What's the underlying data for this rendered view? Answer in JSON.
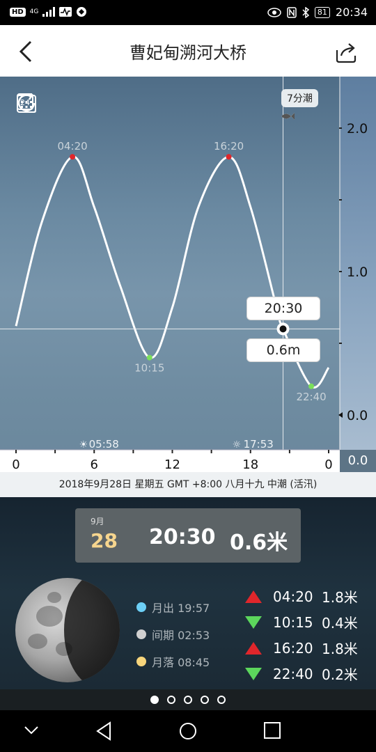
{
  "status": {
    "network_badges": [
      "HD",
      "4G"
    ],
    "battery": "81",
    "time": "20:34"
  },
  "header": {
    "title": "曹妃甸溯河大桥"
  },
  "chart": {
    "tide_badge": "7分潮",
    "cursor_time": "20:30",
    "cursor_height": "0.6m",
    "sunrise": "05:58",
    "sunset": "17:53",
    "zero_box": "0.0"
  },
  "chart_data": {
    "type": "line",
    "series": [
      {
        "points": [
          [
            0,
            0.62
          ],
          [
            2,
            1.35
          ],
          [
            4.33,
            1.8
          ],
          [
            6,
            1.45
          ],
          [
            8,
            0.9
          ],
          [
            10.25,
            0.4
          ],
          [
            12,
            0.75
          ],
          [
            14,
            1.45
          ],
          [
            16.33,
            1.8
          ],
          [
            18,
            1.45
          ],
          [
            20,
            0.75
          ],
          [
            20.5,
            0.6
          ],
          [
            22.67,
            0.2
          ],
          [
            24,
            0.33
          ]
        ]
      }
    ],
    "extremes": [
      {
        "time": "04:20",
        "value": 1.8,
        "kind": "high"
      },
      {
        "time": "10:15",
        "value": 0.4,
        "kind": "low"
      },
      {
        "time": "16:20",
        "value": 1.8,
        "kind": "high"
      },
      {
        "time": "22:40",
        "value": 0.2,
        "kind": "low"
      }
    ],
    "x_ticks": [
      "0",
      "6",
      "12",
      "18",
      "0"
    ],
    "y_ticks": [
      "2.0",
      "1.0",
      "0.0"
    ],
    "xlim": [
      0,
      24
    ],
    "ylim": [
      0,
      2.0
    ]
  },
  "dateline": "2018年9月28日  星期五  GMT +8:00  八月十九  中潮 (活汛)",
  "info": {
    "month": "9月",
    "day": "28",
    "time": "20:30",
    "height": "0.6米"
  },
  "moon": {
    "rise": "月出 19:57",
    "interval": "间期 02:53",
    "set": "月落 08:45",
    "colors": {
      "rise": "#6ccff6",
      "interval": "#d0d0d0",
      "set": "#f7d57c"
    }
  },
  "tides": [
    {
      "dir": "up",
      "time": "04:20",
      "height": "1.8米"
    },
    {
      "dir": "down",
      "time": "10:15",
      "height": "0.4米"
    },
    {
      "dir": "up",
      "time": "16:20",
      "height": "1.8米"
    },
    {
      "dir": "down",
      "time": "22:40",
      "height": "0.2米"
    }
  ],
  "pager": {
    "count": 5,
    "active": 1
  }
}
